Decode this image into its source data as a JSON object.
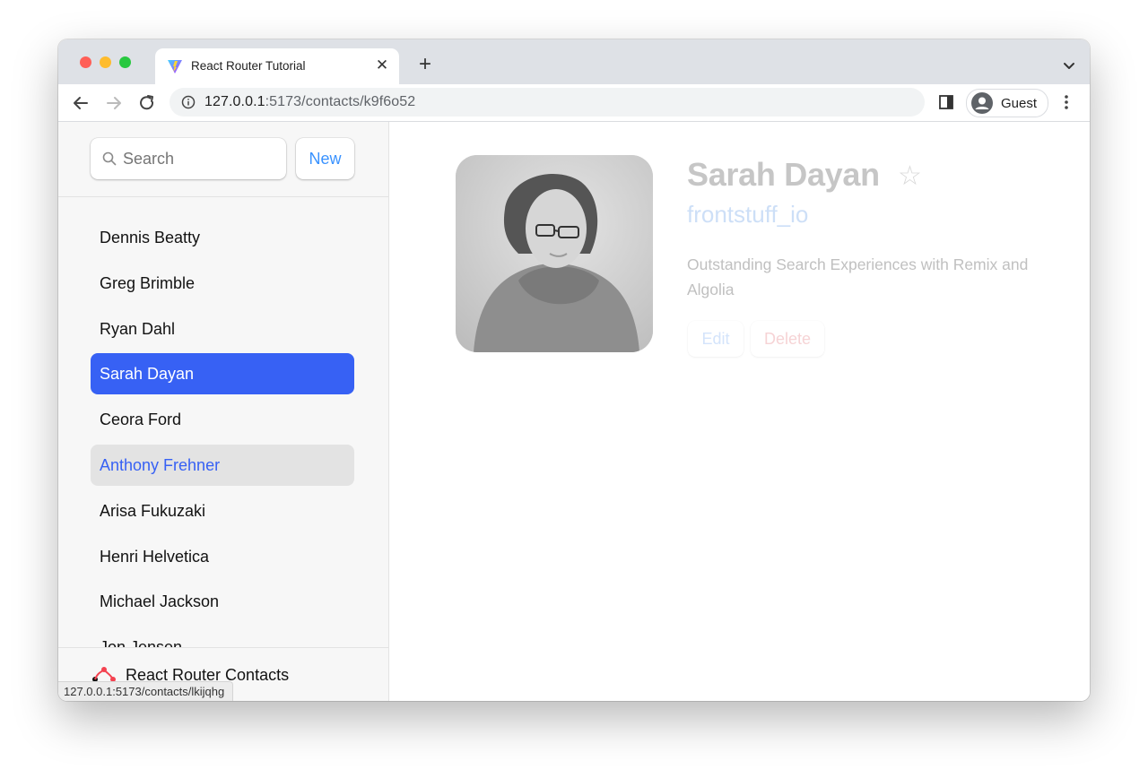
{
  "browser": {
    "tab_title": "React Router Tutorial",
    "new_tab_symbol": "+",
    "close_symbol": "✕",
    "url_host": "127.0.0.1",
    "url_path": ":5173/contacts/k9f6o52",
    "profile_label": "Guest",
    "status_url": "127.0.0.1:5173/contacts/lkijqhg"
  },
  "sidebar": {
    "search_placeholder": "Search",
    "new_button": "New",
    "contacts": [
      {
        "name": "Dennis Beatty",
        "state": "normal"
      },
      {
        "name": "Greg Brimble",
        "state": "normal"
      },
      {
        "name": "Ryan Dahl",
        "state": "normal"
      },
      {
        "name": "Sarah Dayan",
        "state": "active"
      },
      {
        "name": "Ceora Ford",
        "state": "normal"
      },
      {
        "name": "Anthony Frehner",
        "state": "pending"
      },
      {
        "name": "Arisa Fukuzaki",
        "state": "normal"
      },
      {
        "name": "Henri Helvetica",
        "state": "normal"
      },
      {
        "name": "Michael Jackson",
        "state": "normal"
      },
      {
        "name": "Jon Jensen",
        "state": "normal"
      }
    ],
    "footer_title": "React Router Contacts"
  },
  "contact": {
    "name": "Sarah Dayan",
    "favorite_symbol": "☆",
    "twitter": "frontstuff_io",
    "notes": "Outstanding Search Experiences with Remix and Algolia",
    "edit_button": "Edit",
    "delete_button": "Delete"
  },
  "colors": {
    "accent": "#3761f4",
    "link": "#3992ff",
    "delete": "#f44250"
  }
}
